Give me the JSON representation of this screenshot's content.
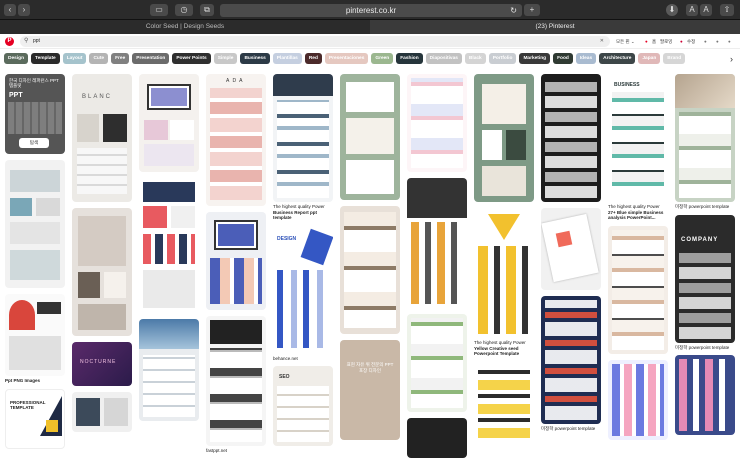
{
  "browser": {
    "url": "pinterest.co.kr",
    "tab_left": "Color Seed | Design Seeds",
    "tab_right": "(23) Pinterest",
    "buttons": [
      "‹",
      "›",
      "▭",
      "◷",
      "⧉"
    ],
    "right_buttons": [
      "⬇",
      "A",
      "A",
      "⇧"
    ],
    "reload_icon": "↻",
    "new_tab": "+"
  },
  "header": {
    "logo": "P",
    "search_value": "ppt",
    "search_icon": "⚲",
    "clear": "✕",
    "right_items": [
      "모든 핀 ⌄",
      "●",
      "홈",
      "팔로잉",
      "●",
      "수정",
      "●",
      "●",
      "●"
    ]
  },
  "chips": [
    {
      "label": "Design",
      "color": "#5b6b5d"
    },
    {
      "label": "Template",
      "color": "#2b2b2b"
    },
    {
      "label": "Layout",
      "color": "#a5c3cc"
    },
    {
      "label": "Cute",
      "color": "#b4b4b4"
    },
    {
      "label": "Free",
      "color": "#808080"
    },
    {
      "label": "Presentation",
      "color": "#6b6b6b"
    },
    {
      "label": "Power Points",
      "color": "#2f2f2f"
    },
    {
      "label": "Simple",
      "color": "#c8c8c8"
    },
    {
      "label": "Business",
      "color": "#2c3a46"
    },
    {
      "label": "Plantillas",
      "color": "#c5cfe0"
    },
    {
      "label": "Red",
      "color": "#4b2a2a"
    },
    {
      "label": "Presentaciones",
      "color": "#e5c8c0"
    },
    {
      "label": "Green",
      "color": "#9bb78f"
    },
    {
      "label": "Fashion",
      "color": "#26353b"
    },
    {
      "label": "Diapositivas",
      "color": "#c2c2c2"
    },
    {
      "label": "Black",
      "color": "#d4d4d4"
    },
    {
      "label": "Portfolio",
      "color": "#c9cdd2"
    },
    {
      "label": "Marketing",
      "color": "#393939"
    },
    {
      "label": "Food",
      "color": "#2f3a32"
    },
    {
      "label": "Ideas",
      "color": "#a9bbd0"
    },
    {
      "label": "Architecture",
      "color": "#3d4648"
    },
    {
      "label": "Japan",
      "color": "#e0b8b8"
    },
    {
      "label": "Brand",
      "color": "#d6d6d6"
    }
  ],
  "chip_arrow": "›",
  "pin_texts": {
    "c0_title": "PPT",
    "c0_sub": "한국 디자인 레퍼런스 PPT 템플릿",
    "c0_btn": "탐색",
    "c0_caption": "Ppt PNG Images",
    "c0_bottom": "PROFESSIONAL TEMPLATE",
    "c1_blanc": "BLANC",
    "c1_pink": "NOCTURNE",
    "c3_ada": "A D A",
    "c4_cap1": "The highest quality Power",
    "c4_cap2": "Business Report ppt template",
    "c4_design": "DESIGN",
    "c4_cap3": "behance.net",
    "c4_seo": "SEO",
    "c5_kr": "표현 자유 위 전문의 PPT 포장 디자인",
    "c7_cap1": "The highest quality Power",
    "c7_cap2": "Yellow Creative seed Powerpoint Template",
    "c8_cap1": "미정학 powerpoint template",
    "c9_business": "BUSINESS",
    "c9_cap1": "The highest quality Power",
    "c9_cap2": "27+ Blue simple Business analysis PowerPoint...",
    "c10_cap1": "미정학 powerpoint template",
    "c10_company": "COMPANY",
    "c10_cap2": "미정학 powerpoint template",
    "c3_cap": "fastppt.net"
  }
}
